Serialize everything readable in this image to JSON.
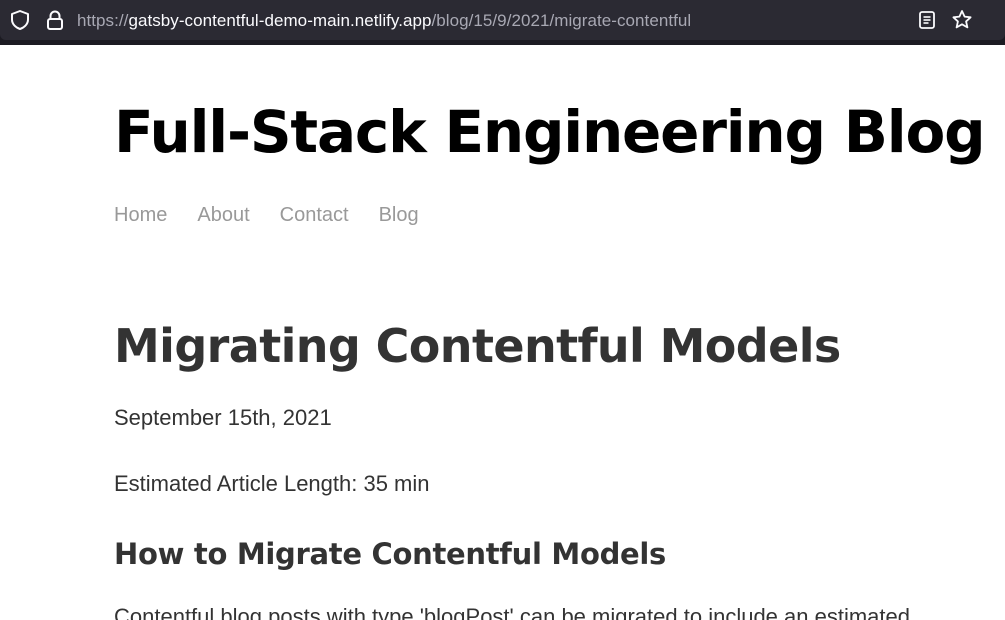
{
  "browser": {
    "url_prefix": "https://",
    "url_host": "gatsby-contentful-demo-main.netlify.app",
    "url_path": "/blog/15/9/2021/migrate-contentful",
    "icons": [
      "shield-icon",
      "lock-icon",
      "reader-view-icon",
      "bookmark-star-icon"
    ]
  },
  "site": {
    "title": "Full-Stack Engineering Blog",
    "nav": [
      "Home",
      "About",
      "Contact",
      "Blog"
    ]
  },
  "post": {
    "title": "Migrating Contentful Models",
    "date": "September 15th, 2021",
    "length": "Estimated Article Length: 35 min",
    "section_heading": "How to Migrate Contentful Models",
    "body_first_line": "Contentful blog posts with type 'blogPost' can be migrated to include an estimated"
  },
  "colors": {
    "browser_chrome": "#1c1b22",
    "urlbar": "#2b2a33",
    "nav_link": "#999999",
    "heading": "#333333"
  }
}
